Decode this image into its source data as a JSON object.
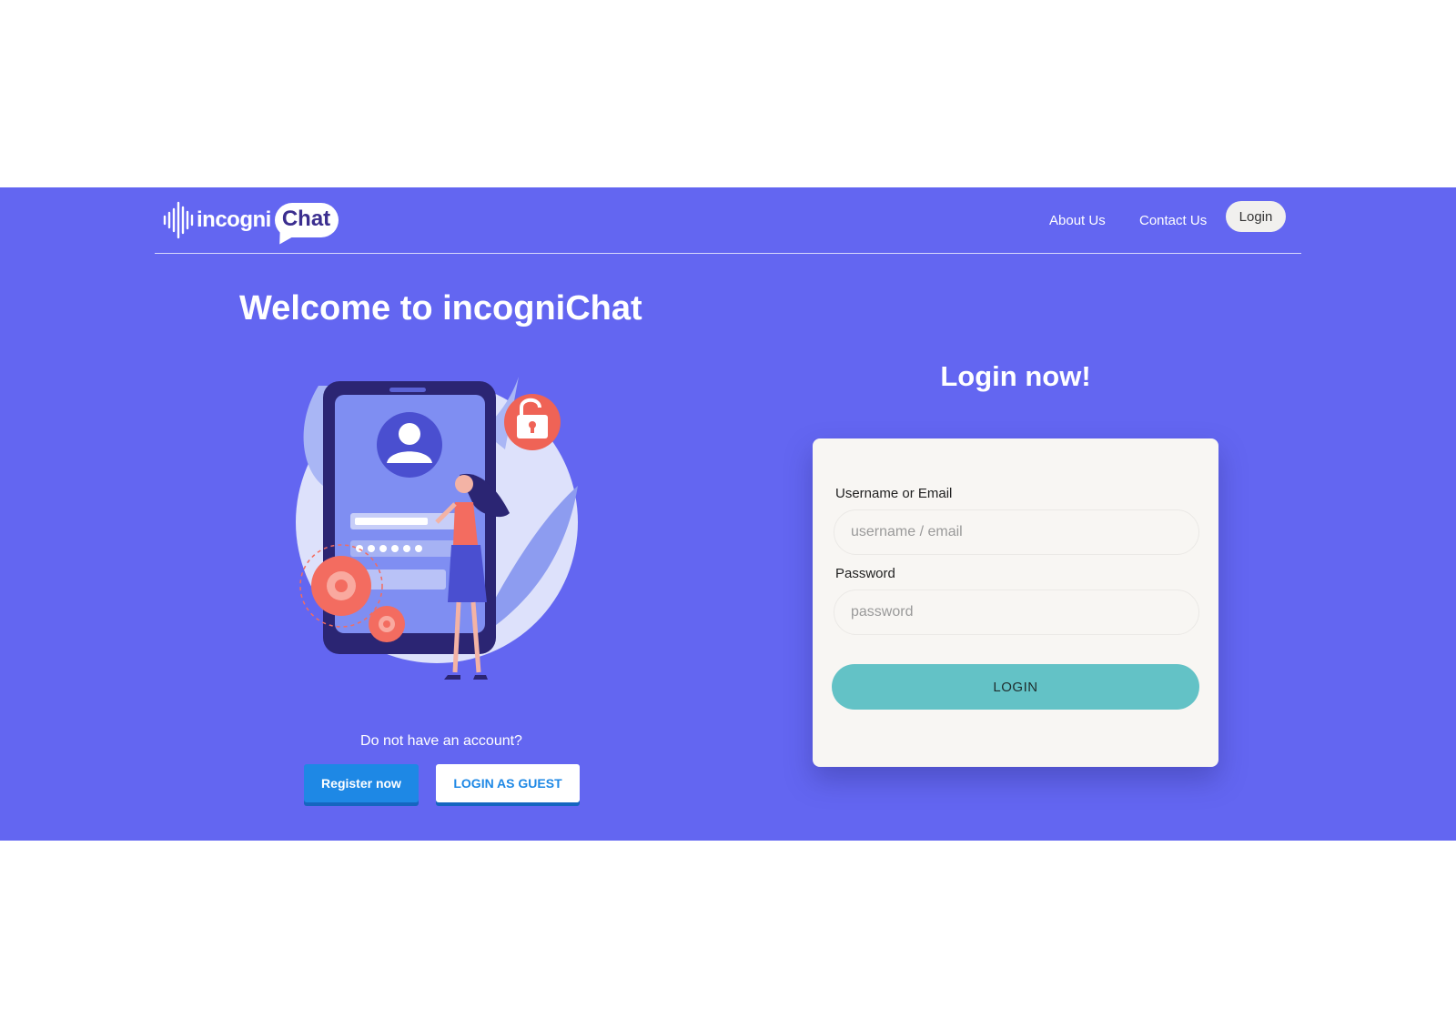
{
  "brand": {
    "logo_part1": "incogni",
    "logo_part2": "Chat"
  },
  "nav": {
    "about": "About Us",
    "contact": "Contact Us",
    "login": "Login"
  },
  "hero": {
    "title": "Welcome to incogniChat",
    "no_account": "Do not have an account?",
    "register_label": "Register now",
    "guest_label": "LOGIN AS GUEST"
  },
  "login": {
    "title": "Login now!",
    "username_label": "Username or Email",
    "username_placeholder": "username / email",
    "password_label": "Password",
    "password_placeholder": "password",
    "submit_label": "LOGIN"
  },
  "colors": {
    "band": "#6366f1",
    "card": "#f8f6f3",
    "login_button": "#63c2c6",
    "register_button": "#1e88e5",
    "accent_coral": "#f36c60"
  },
  "icons": {
    "logo_wave": "sound-wave-icon",
    "illustration": "mobile-login-illustration",
    "padlock": "unlocked-padlock-icon",
    "avatar": "user-avatar-icon",
    "gears": "gear-icon"
  }
}
